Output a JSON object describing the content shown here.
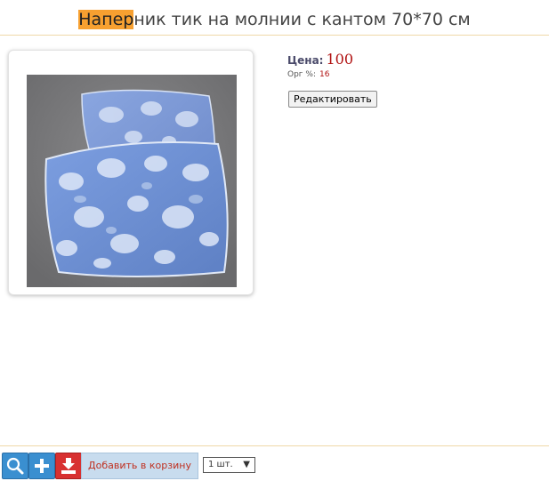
{
  "product": {
    "title_highlight": "Напер",
    "title_rest": "ник тик на молнии с кантом 70*70 см"
  },
  "price": {
    "label": "Цена:",
    "value": "100"
  },
  "org": {
    "label": "Орг %:",
    "value": "16"
  },
  "edit_label": "Редактировать",
  "toolbar": {
    "add_to_cart_label": "Добавить в корзину",
    "quantity_value": "1 шт.",
    "icons": [
      "search-icon",
      "plus-icon",
      "download-cart-icon"
    ]
  },
  "colors": {
    "highlight": "#f7a030",
    "price": "#b01010",
    "accent_blue": "#3a8fd0",
    "accent_red": "#d83030"
  }
}
